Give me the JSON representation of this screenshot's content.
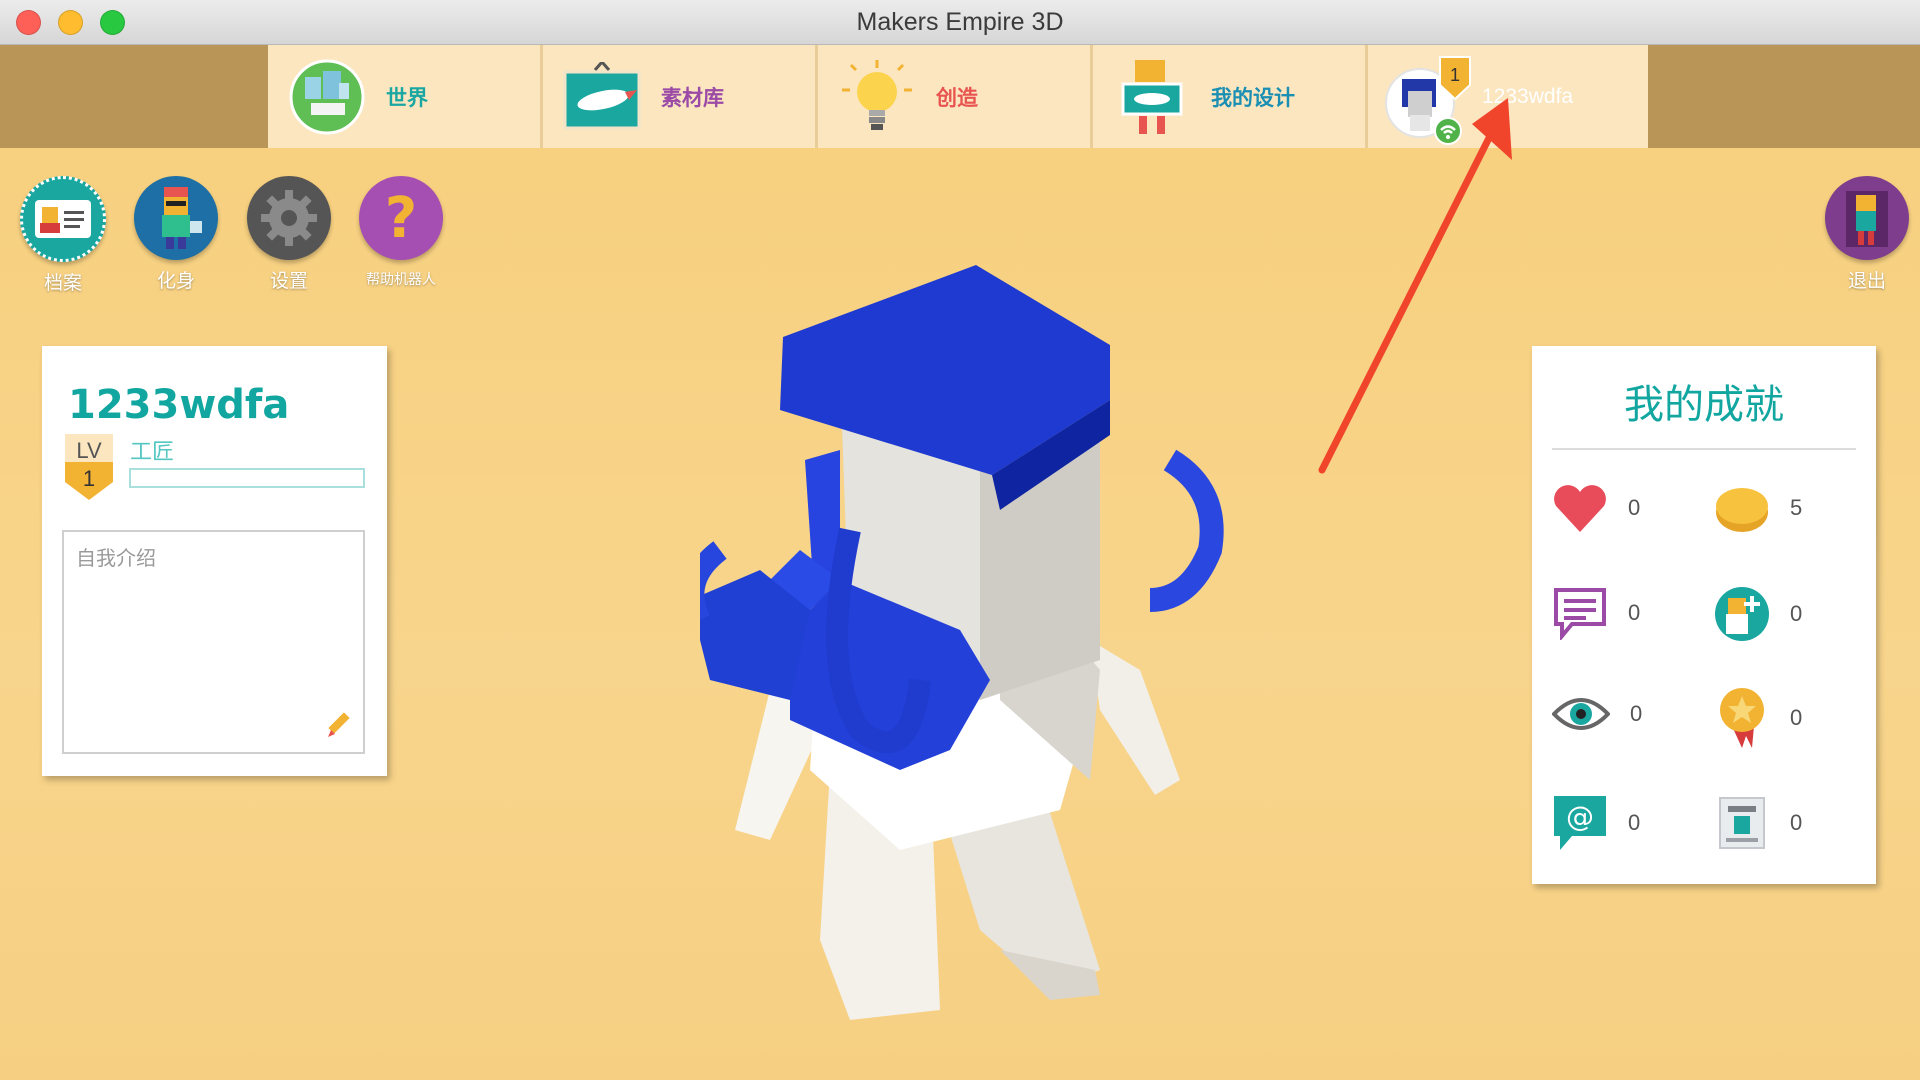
{
  "window": {
    "title": "Makers Empire 3D"
  },
  "nav": {
    "tabs": [
      {
        "label": "世界",
        "color": "#1aa7a2",
        "icon": "world-icon"
      },
      {
        "label": "素材库",
        "color": "#9b4aa6",
        "icon": "library-icon"
      },
      {
        "label": "创造",
        "color": "#e8544f",
        "icon": "lightbulb-icon"
      },
      {
        "label": "我的设计",
        "color": "#1a8fb3",
        "icon": "my-designs-icon"
      }
    ],
    "user": {
      "name": "1233wdfa",
      "level_badge": "1"
    }
  },
  "tools": [
    {
      "label": "档案",
      "icon": "profile-card-icon"
    },
    {
      "label": "化身",
      "icon": "avatar-icon"
    },
    {
      "label": "设置",
      "icon": "gear-icon"
    },
    {
      "label": "帮助机器人",
      "icon": "help-icon"
    }
  ],
  "logout": {
    "label": "退出"
  },
  "profile": {
    "name": "1233wdfa",
    "lv_label": "LV",
    "lv_value": "1",
    "rank": "工匠",
    "xp_fraction": 0,
    "bio_placeholder": "自我介绍"
  },
  "achievements": {
    "title": "我的成就",
    "items": [
      {
        "icon": "heart-icon",
        "count": "0"
      },
      {
        "icon": "coin-icon",
        "count": "5"
      },
      {
        "icon": "comment-icon",
        "count": "0"
      },
      {
        "icon": "add-friend-icon",
        "count": "0"
      },
      {
        "icon": "eye-icon",
        "count": "0"
      },
      {
        "icon": "medal-icon",
        "count": "0"
      },
      {
        "icon": "mention-icon",
        "count": "0"
      },
      {
        "icon": "printer-icon",
        "count": "0"
      }
    ]
  },
  "colors": {
    "accent_teal": "#12a6a0",
    "arrow_red": "#f0452a",
    "hair_blue": "#2a44d6"
  }
}
